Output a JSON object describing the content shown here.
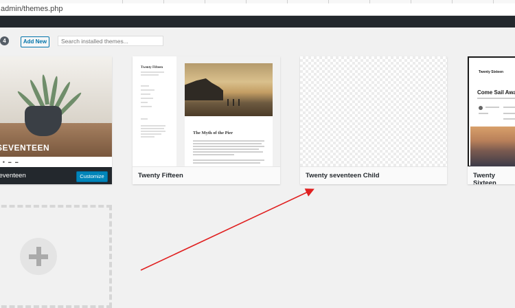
{
  "browser": {
    "url": "admin/themes.php"
  },
  "toolbar": {
    "count": "4",
    "add_new_label": "Add New",
    "search_placeholder": "Search installed themes..."
  },
  "themes": [
    {
      "name": "nty Seventeen",
      "screenshot_title": "TY SEVENTEEN",
      "active": true,
      "customize_label": "Customize"
    },
    {
      "name": "Twenty Fifteen",
      "screenshot_site_title": "Twenty Fifteen",
      "screenshot_post_title": "The Myth of the Pier"
    },
    {
      "name": "Twenty seventeen Child"
    },
    {
      "name": "Twenty Sixteen",
      "screenshot_site_title": "Twenty Sixteen",
      "screenshot_post_title": "Come Sail Away w"
    }
  ],
  "annotation": {
    "arrow_color": "#e02020"
  },
  "colors": {
    "admin_bar": "#23282d",
    "primary": "#0085ba",
    "link": "#0073aa"
  }
}
